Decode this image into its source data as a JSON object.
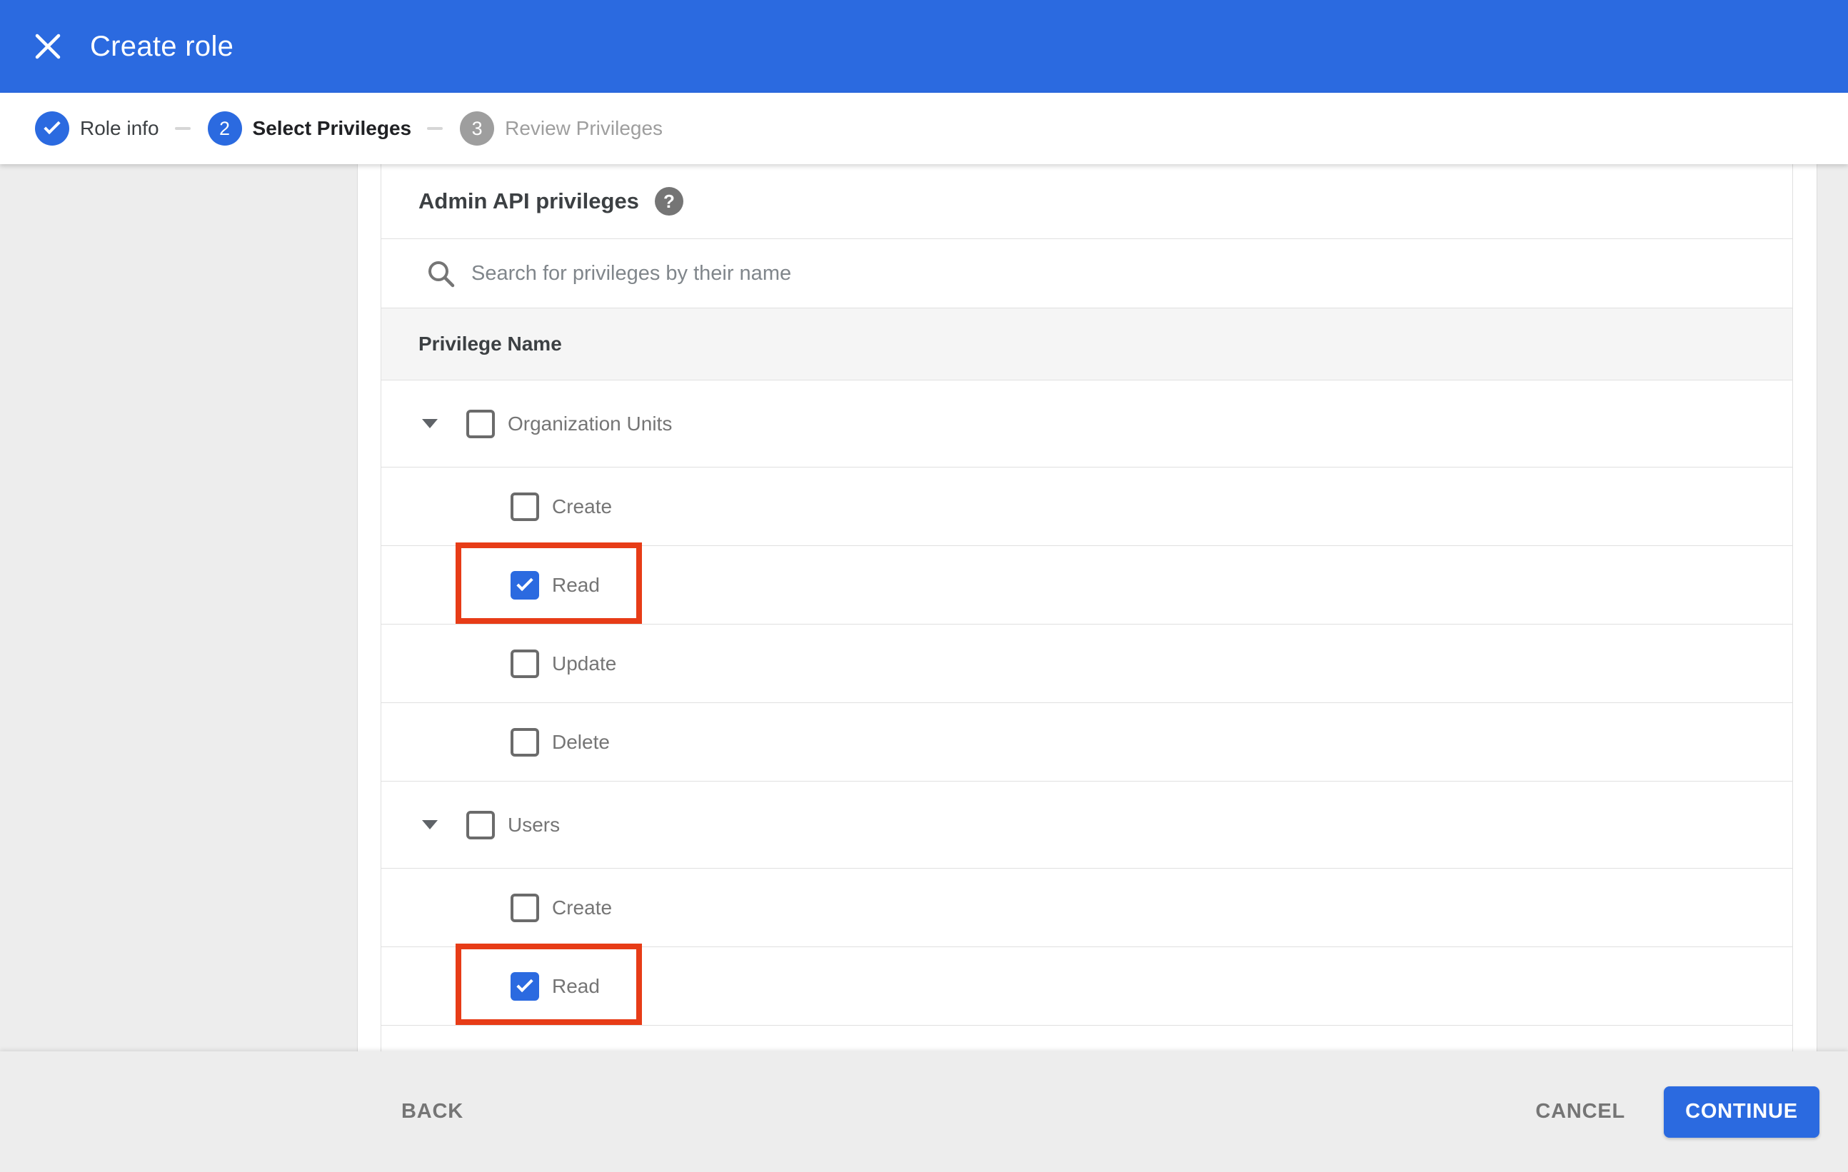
{
  "colors": {
    "accent_blue": "#2b6ae0",
    "annotation_red": "#e73c17",
    "page_bg": "#ededed",
    "row_border": "#e0e0e0",
    "table_header_bg": "#f5f5f5"
  },
  "header": {
    "title": "Create role",
    "close_icon": "x-icon"
  },
  "stepper": {
    "steps": [
      {
        "number": "1",
        "label": "Role info",
        "state": "completed",
        "icon": "checkmark-icon"
      },
      {
        "number": "2",
        "label": "Select Privileges",
        "state": "current"
      },
      {
        "number": "3",
        "label": "Review Privileges",
        "state": "upcoming"
      }
    ]
  },
  "privileges": {
    "section_title": "Admin API privileges",
    "help_icon_glyph": "?",
    "search_placeholder": "Search for privileges by their name",
    "column_header": "Privilege Name",
    "groups": [
      {
        "label": "Organization Units",
        "checked": false,
        "expanded": true,
        "children": [
          {
            "label": "Create",
            "checked": false,
            "highlighted": false
          },
          {
            "label": "Read",
            "checked": true,
            "highlighted": true
          },
          {
            "label": "Update",
            "checked": false,
            "highlighted": false
          },
          {
            "label": "Delete",
            "checked": false,
            "highlighted": false
          }
        ]
      },
      {
        "label": "Users",
        "checked": false,
        "expanded": true,
        "children": [
          {
            "label": "Create",
            "checked": false,
            "highlighted": false
          },
          {
            "label": "Read",
            "checked": true,
            "highlighted": true
          }
        ]
      }
    ]
  },
  "footer": {
    "back_label": "BACK",
    "cancel_label": "CANCEL",
    "continue_label": "CONTINUE"
  }
}
